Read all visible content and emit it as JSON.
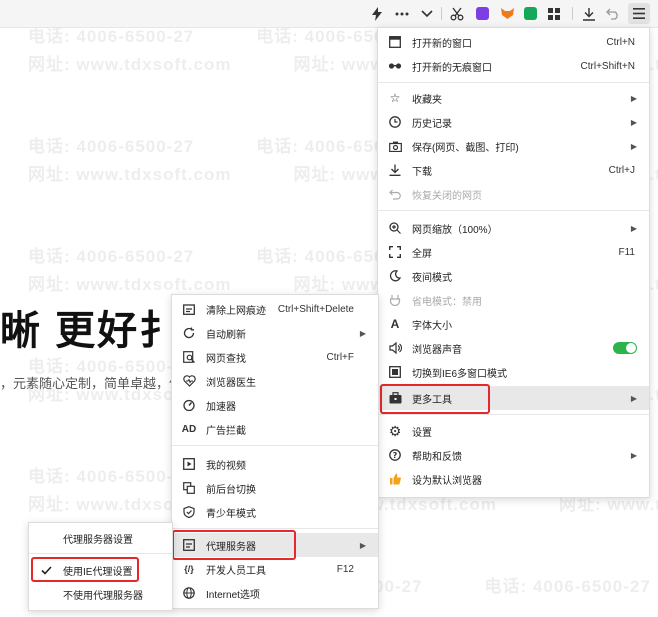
{
  "watermark": {
    "phone": "电话: 4006-6500-27",
    "web": "网址: www.tdxsoft.com"
  },
  "page": {
    "headline": "晰  更好扌",
    "subline": "，元素随心定制，简单卓越，体"
  },
  "toolbar": {
    "items": [
      "lightning-icon",
      "more-icon",
      "chevron-down-icon",
      "scissors-icon",
      "purple-app-icon",
      "fox-icon",
      "green-app-icon",
      "grid-icon",
      "download-icon",
      "undo-icon",
      "hamburger-menu-icon"
    ]
  },
  "main_menu": {
    "items": [
      {
        "label": "打开新的窗口",
        "shortcut": "Ctrl+N",
        "icon": "window-icon"
      },
      {
        "label": "打开新的无痕窗口",
        "shortcut": "Ctrl+Shift+N",
        "icon": "incognito-icon"
      },
      {
        "label": "收藏夹",
        "icon": "star-icon"
      },
      {
        "label": "历史记录",
        "icon": "clock-icon"
      },
      {
        "label": "保存(网页、截图、打印)",
        "icon": "camera-icon"
      },
      {
        "label": "下载",
        "shortcut": "Ctrl+J",
        "icon": "download-icon"
      },
      {
        "label": "恢复关闭的网页",
        "icon": "undo-icon"
      },
      {
        "label": "网页缩放（100%）",
        "icon": "zoom-icon"
      },
      {
        "label": "全屏",
        "shortcut": "F11",
        "icon": "fullscreen-icon"
      },
      {
        "label": "夜间模式",
        "icon": "moon-icon"
      },
      {
        "label": "省电模式：禁用",
        "icon": "power-icon"
      },
      {
        "label": "字体大小",
        "icon": "font-icon"
      },
      {
        "label": "浏览器声音",
        "icon": "speaker-icon"
      },
      {
        "label": "切换到IE6多窗口模式",
        "icon": "ie-icon"
      },
      {
        "label": "更多工具",
        "icon": "toolbox-icon"
      },
      {
        "label": "设置",
        "icon": "gear-icon"
      },
      {
        "label": "帮助和反馈",
        "icon": "help-icon"
      },
      {
        "label": "设为默认浏览器",
        "icon": "thumb-icon"
      }
    ]
  },
  "tools_menu": {
    "items": [
      {
        "label": "清除上网痕迹",
        "shortcut": "Ctrl+Shift+Delete"
      },
      {
        "label": "自动刷新"
      },
      {
        "label": "网页查找",
        "shortcut": "Ctrl+F"
      },
      {
        "label": "浏览器医生"
      },
      {
        "label": "加速器"
      },
      {
        "label": "广告拦截"
      },
      {
        "label": "我的视频"
      },
      {
        "label": "前后台切换"
      },
      {
        "label": "青少年模式"
      },
      {
        "label": "代理服务器"
      },
      {
        "label": "开发人员工具",
        "shortcut": "F12"
      },
      {
        "label": "Internet选项"
      }
    ]
  },
  "proxy_menu": {
    "items": [
      {
        "label": "代理服务器设置"
      },
      {
        "label": "使用IE代理设置"
      },
      {
        "label": "不使用代理服务器"
      }
    ]
  }
}
